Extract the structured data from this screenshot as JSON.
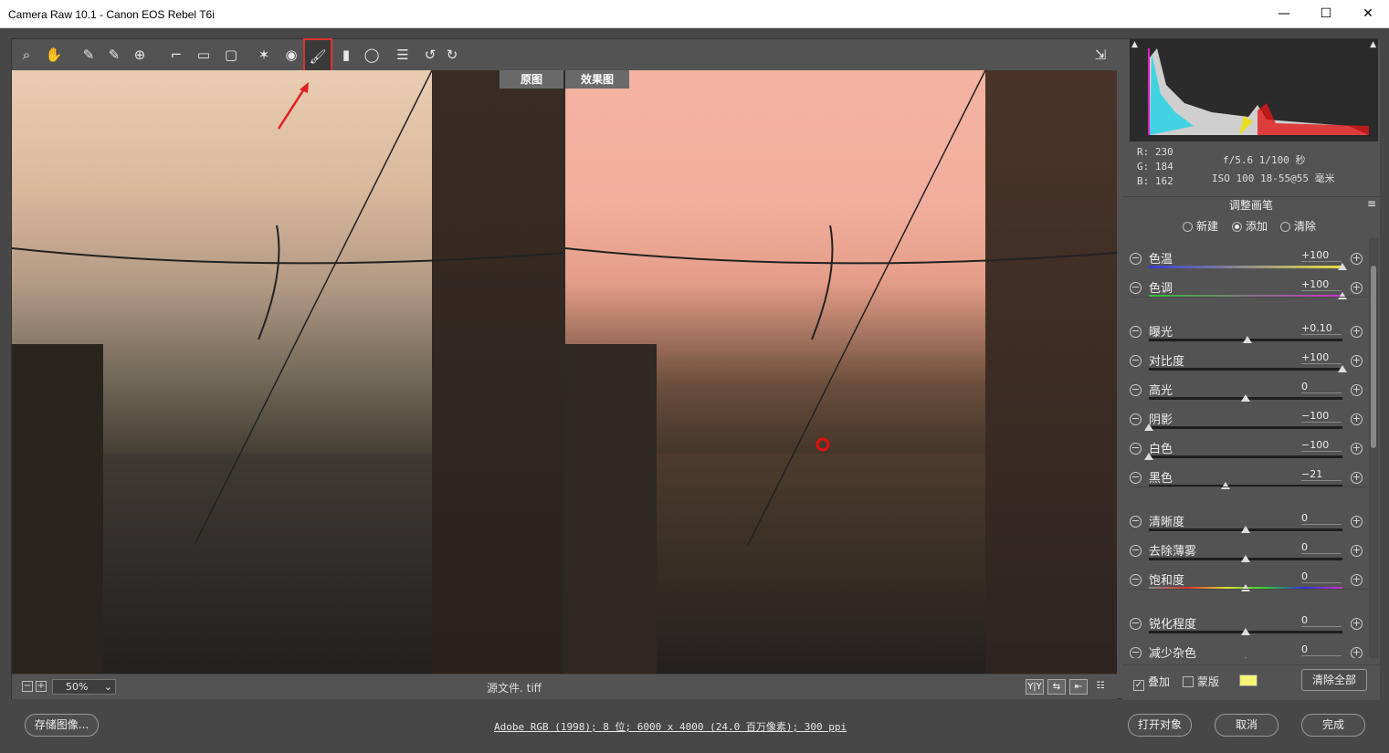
{
  "window": {
    "title": "Camera Raw 10.1 -  Canon EOS Rebel T6i",
    "minimize": "—",
    "maximize": "☐",
    "close": "✕"
  },
  "toolbar": {
    "icons": [
      "zoom-icon",
      "hand-icon",
      "white-balance-icon",
      "color-sampler-icon",
      "targeted-adjustment-icon",
      "crop-icon",
      "straighten-icon",
      "transform-icon",
      "spot-removal-icon",
      "red-eye-icon",
      "adjustment-brush-icon",
      "graduated-filter-icon",
      "radial-filter-icon",
      "preferences-icon",
      "rotate-ccw-icon",
      "rotate-cw-icon"
    ],
    "glyphs": [
      "⌕",
      "✋",
      "✎",
      "✎",
      "⊕",
      "⌐",
      "▭",
      "▢",
      "✶",
      "◉",
      "🖌",
      "▮",
      "◯",
      "☰",
      "↺",
      "↻"
    ],
    "fullscreen_glyph": "⇲",
    "active": "adjustment-brush-icon",
    "accent": "#e03030"
  },
  "preview": {
    "before_label": "原图",
    "after_label": "效果图"
  },
  "bottombar": {
    "zoom_minus": "−",
    "zoom_plus": "+",
    "zoom": "50%",
    "filename": "源文件. tiff",
    "view_yy": "Y|Y",
    "view_swap": "⇆",
    "view_copy": "⇤",
    "view_settings": "☷"
  },
  "histogram": {
    "clip_shadow": "▲",
    "clip_highlight": "▲"
  },
  "info": {
    "r": "R:  230",
    "g": "G:  184",
    "b": "B:  162",
    "exposure": "f/5.6   1/100 秒",
    "iso": "ISO 100   18-55@55 毫米"
  },
  "panel": {
    "title": "调整画笔",
    "menu": "≡",
    "modes": [
      "新建",
      "添加",
      "清除"
    ],
    "active_mode": "添加",
    "sliders": [
      {
        "label": "色温",
        "value": "+100",
        "pos": 1.0
      },
      {
        "label": "色调",
        "value": "+100",
        "pos": 1.0
      },
      {
        "label": "曝光",
        "value": "+0.10",
        "pos": 0.51
      },
      {
        "label": "对比度",
        "value": "+100",
        "pos": 1.0
      },
      {
        "label": "高光",
        "value": "0",
        "pos": 0.5
      },
      {
        "label": "阴影",
        "value": "−100",
        "pos": 0.0
      },
      {
        "label": "白色",
        "value": "−100",
        "pos": 0.0
      },
      {
        "label": "黑色",
        "value": "−21",
        "pos": 0.395
      },
      {
        "label": "清晰度",
        "value": "0",
        "pos": 0.5
      },
      {
        "label": "去除薄雾",
        "value": "0",
        "pos": 0.5
      },
      {
        "label": "饱和度",
        "value": "0",
        "pos": 0.5
      },
      {
        "label": "锐化程度",
        "value": "0",
        "pos": 0.5
      },
      {
        "label": "减少杂色",
        "value": "0",
        "pos": 0.5
      }
    ],
    "overlay_label": "叠加",
    "overlay_checked": true,
    "mask_label": "蒙版",
    "mask_color": "#f6f476",
    "clear_all": "清除全部"
  },
  "footer": {
    "save": "存储图像...",
    "workflow": "Adobe RGB (1998); 8 位;  6000 x 4000 (24.0 百万像素); 300 ppi",
    "open_object": "打开对象",
    "cancel": "取消",
    "done": "完成"
  }
}
